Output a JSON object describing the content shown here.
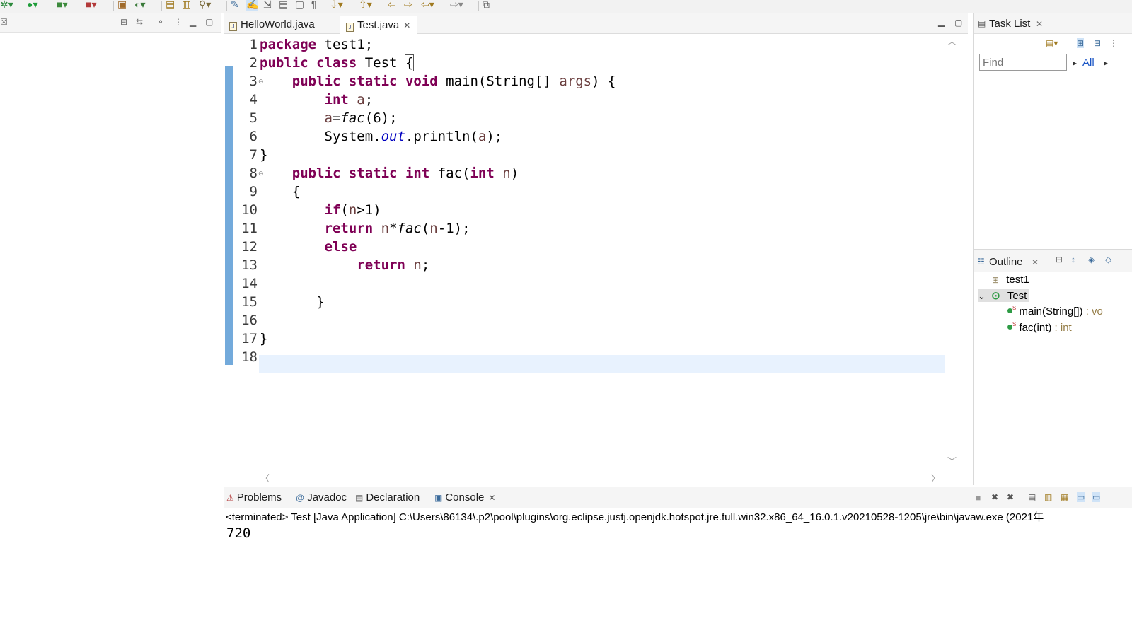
{
  "toolbar": {
    "icons": [
      "debug-icon",
      "run-icon",
      "coverage-icon",
      "external-tools-icon",
      "new-java-project-icon",
      "new-class-icon",
      "open-type-icon",
      "open-task-icon",
      "search-icon",
      "toggle-mark-occurrences-icon",
      "toggle-whitespace-icon",
      "next-annotation-icon",
      "previous-annotation-icon",
      "back-icon",
      "forward-icon",
      "open-perspective-icon"
    ]
  },
  "editor": {
    "tabs": [
      {
        "label": "HelloWorld.java",
        "active": false
      },
      {
        "label": "Test.java",
        "active": true
      }
    ],
    "line_numbers": [
      "1",
      "2",
      "3",
      "4",
      "5",
      "6",
      "7",
      "8",
      "9",
      "10",
      "11",
      "12",
      "13",
      "14",
      "15",
      "16",
      "17",
      "18"
    ],
    "fold_markers": [
      "⊖",
      "⊖"
    ],
    "code": {
      "l1": {
        "kw": "package",
        "rest": " test1;"
      },
      "l2": {
        "kw1": "public",
        "kw2": "class",
        "name": " Test ",
        "brace": "{"
      },
      "l3": {
        "indent": "    ",
        "kw1": "public",
        "kw2": "static",
        "kw3": "void",
        "sig": " main(String[] ",
        "param": "args",
        "end": ") {"
      },
      "l4": {
        "indent": "        ",
        "kw": "int",
        "sp": " ",
        "var": "a",
        "end": ";"
      },
      "l5": {
        "indent": "        ",
        "var": "a",
        "op": "=",
        "call": "fac",
        "end": "(6);"
      },
      "l6": {
        "indent": "        ",
        "pre": "System.",
        "field": "out",
        "mid": ".println(",
        "var": "a",
        "end": ");"
      },
      "l7": {
        "text": "}"
      },
      "l8": {
        "indent": "    ",
        "kw1": "public",
        "kw2": "static",
        "kw3": "int",
        "sig": " fac(",
        "kw4": "int",
        "sp": " ",
        "param": "n",
        "end": ")"
      },
      "l9": {
        "text": "    {"
      },
      "l10": {
        "indent": "        ",
        "kw": "if",
        "open": "(",
        "var": "n",
        "end": ">1)"
      },
      "l11": {
        "indent": "        ",
        "kw": "return",
        "sp": " ",
        "var": "n",
        "op": "*",
        "call": "fac",
        "open": "(",
        "var2": "n",
        "end": "-1);"
      },
      "l12": {
        "indent": "        ",
        "kw": "else"
      },
      "l13": {
        "indent": "            ",
        "kw": "return",
        "sp": " ",
        "var": "n",
        "end": ";"
      },
      "l14": {
        "text": ""
      },
      "l15": {
        "text": "       }"
      },
      "l16": {
        "text": ""
      },
      "l17": {
        "text": "}"
      },
      "l18": {
        "text": ""
      }
    }
  },
  "task_list": {
    "title": "Task List",
    "find_placeholder": "Find",
    "all_label": "All"
  },
  "outline": {
    "title": "Outline",
    "package": "test1",
    "class_name": "Test",
    "members": [
      {
        "name": "main(String[])",
        "type": " : vo"
      },
      {
        "name": "fac(int)",
        "type": " : int"
      }
    ],
    "static_marker": "S"
  },
  "bottom": {
    "tabs": [
      "Problems",
      "Javadoc",
      "Declaration",
      "Console"
    ],
    "tab_icons": [
      "problems-icon",
      "javadoc-icon",
      "declaration-icon",
      "console-icon"
    ],
    "console_status": "<terminated> Test [Java Application] C:\\Users\\86134\\.p2\\pool\\plugins\\org.eclipse.justj.openjdk.hotspot.jre.full.win32.x86_64_16.0.1.v20210528-1205\\jre\\bin\\javaw.exe  (2021年",
    "output": "720"
  },
  "colors": {
    "keyword": "#7f0055",
    "field": "#0000c0",
    "local_variable": "#6a3e3e",
    "current_line": "#e8f2fe",
    "change_marker": "#5b9bd5",
    "link": "#1a55c5"
  }
}
